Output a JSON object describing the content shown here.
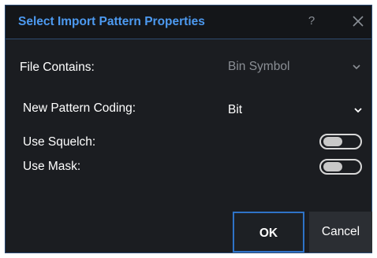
{
  "dialog": {
    "title": "Select Import Pattern Properties",
    "help_label": "?",
    "close_icon": "close-icon"
  },
  "fields": {
    "file_contains": {
      "label": "File Contains:",
      "value": "Bin Symbol",
      "enabled": false
    },
    "new_pattern_coding": {
      "label": "New Pattern Coding:",
      "value": "Bit",
      "enabled": true
    },
    "use_squelch": {
      "label": "Use Squelch:",
      "on": false
    },
    "use_mask": {
      "label": "Use Mask:",
      "on": false
    }
  },
  "buttons": {
    "ok_label": "OK",
    "cancel_label": "Cancel"
  },
  "colors": {
    "title": "#4d9af0",
    "background": "#1b1d21",
    "focus_border": "#2e73c7",
    "disabled_text": "#8b8f95"
  }
}
